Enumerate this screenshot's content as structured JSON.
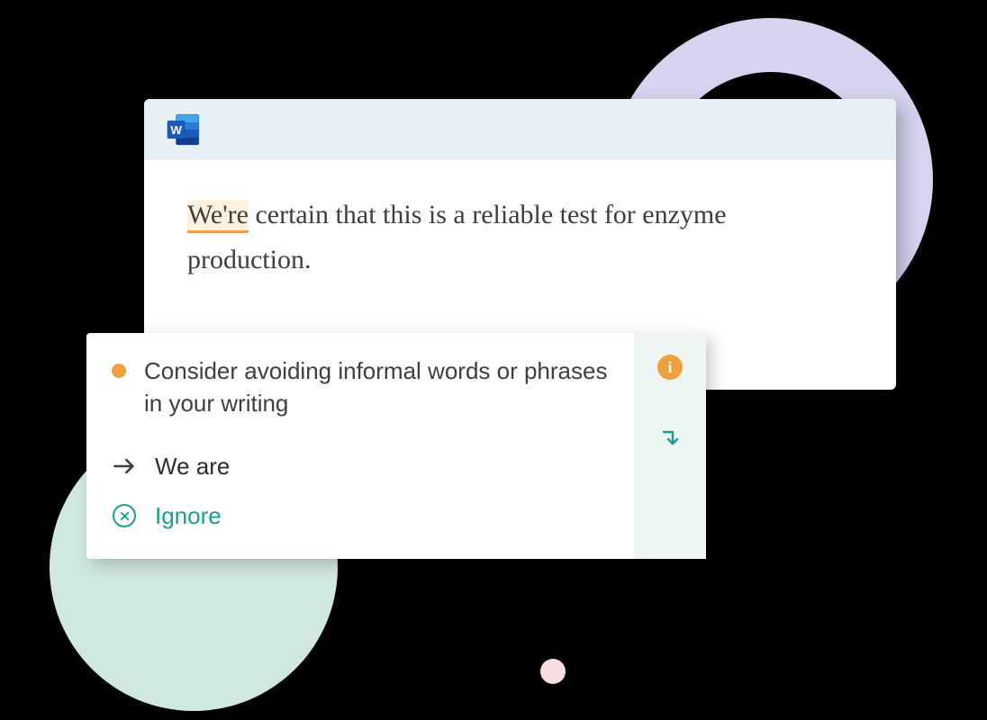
{
  "document": {
    "highlighted_word": "We're",
    "text_after": " certain that this is a reliable test for enzyme production."
  },
  "suggestion": {
    "title": "Consider avoiding informal words or phrases in your writing",
    "replace_option": "We are",
    "ignore_option": "Ignore",
    "info_label": "i"
  }
}
